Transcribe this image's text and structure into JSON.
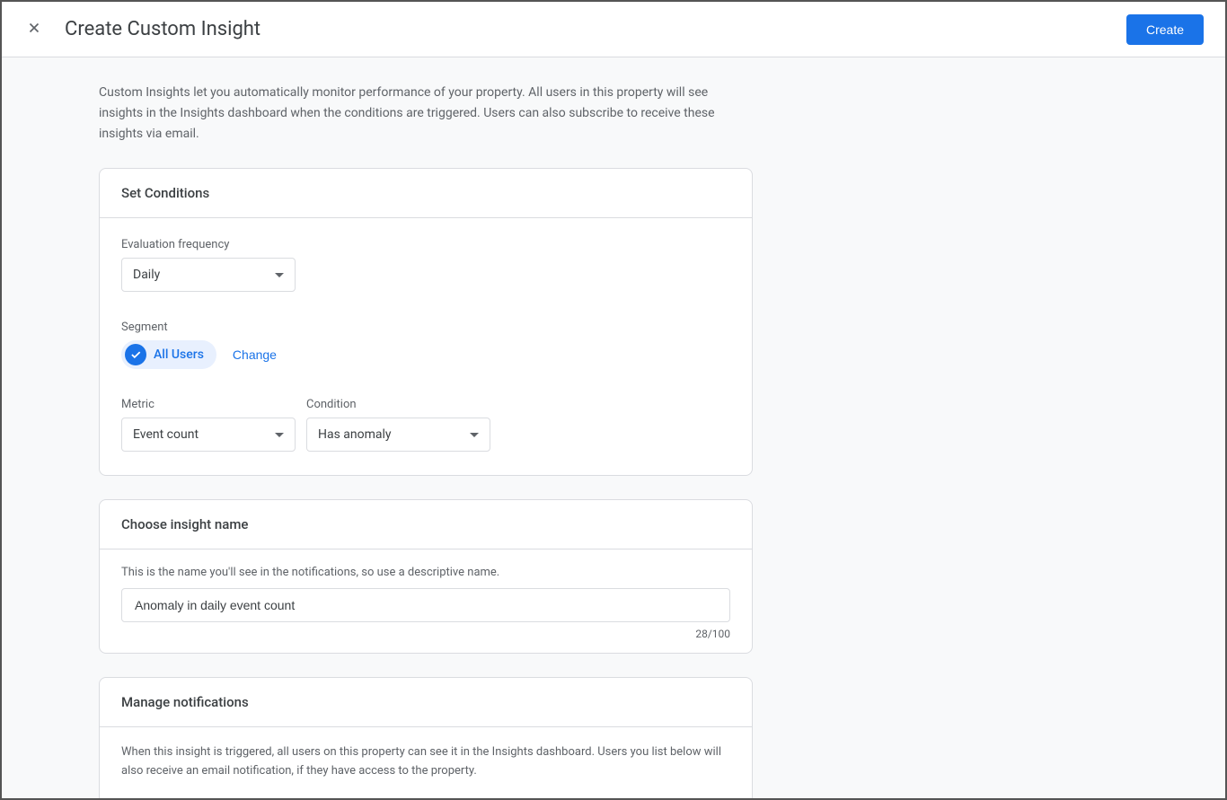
{
  "header": {
    "title": "Create Custom Insight",
    "create_button": "Create"
  },
  "intro": "Custom Insights let you automatically monitor performance of your property. All users in this property will see insights in the Insights dashboard when the conditions are triggered. Users can also subscribe to receive these insights via email.",
  "conditions": {
    "title": "Set Conditions",
    "frequency_label": "Evaluation frequency",
    "frequency_value": "Daily",
    "segment_label": "Segment",
    "segment_chip": "All Users",
    "segment_change": "Change",
    "metric_label": "Metric",
    "metric_value": "Event count",
    "condition_label": "Condition",
    "condition_value": "Has anomaly"
  },
  "name_section": {
    "title": "Choose insight name",
    "help": "This is the name you'll see in the notifications, so use a descriptive name.",
    "value": "Anomaly in daily event count",
    "counter": "28/100"
  },
  "notifications": {
    "title": "Manage notifications",
    "description": "When this insight is triggered, all users on this property can see it in the Insights dashboard. Users you list below will also receive an email notification, if they have access to the property."
  }
}
